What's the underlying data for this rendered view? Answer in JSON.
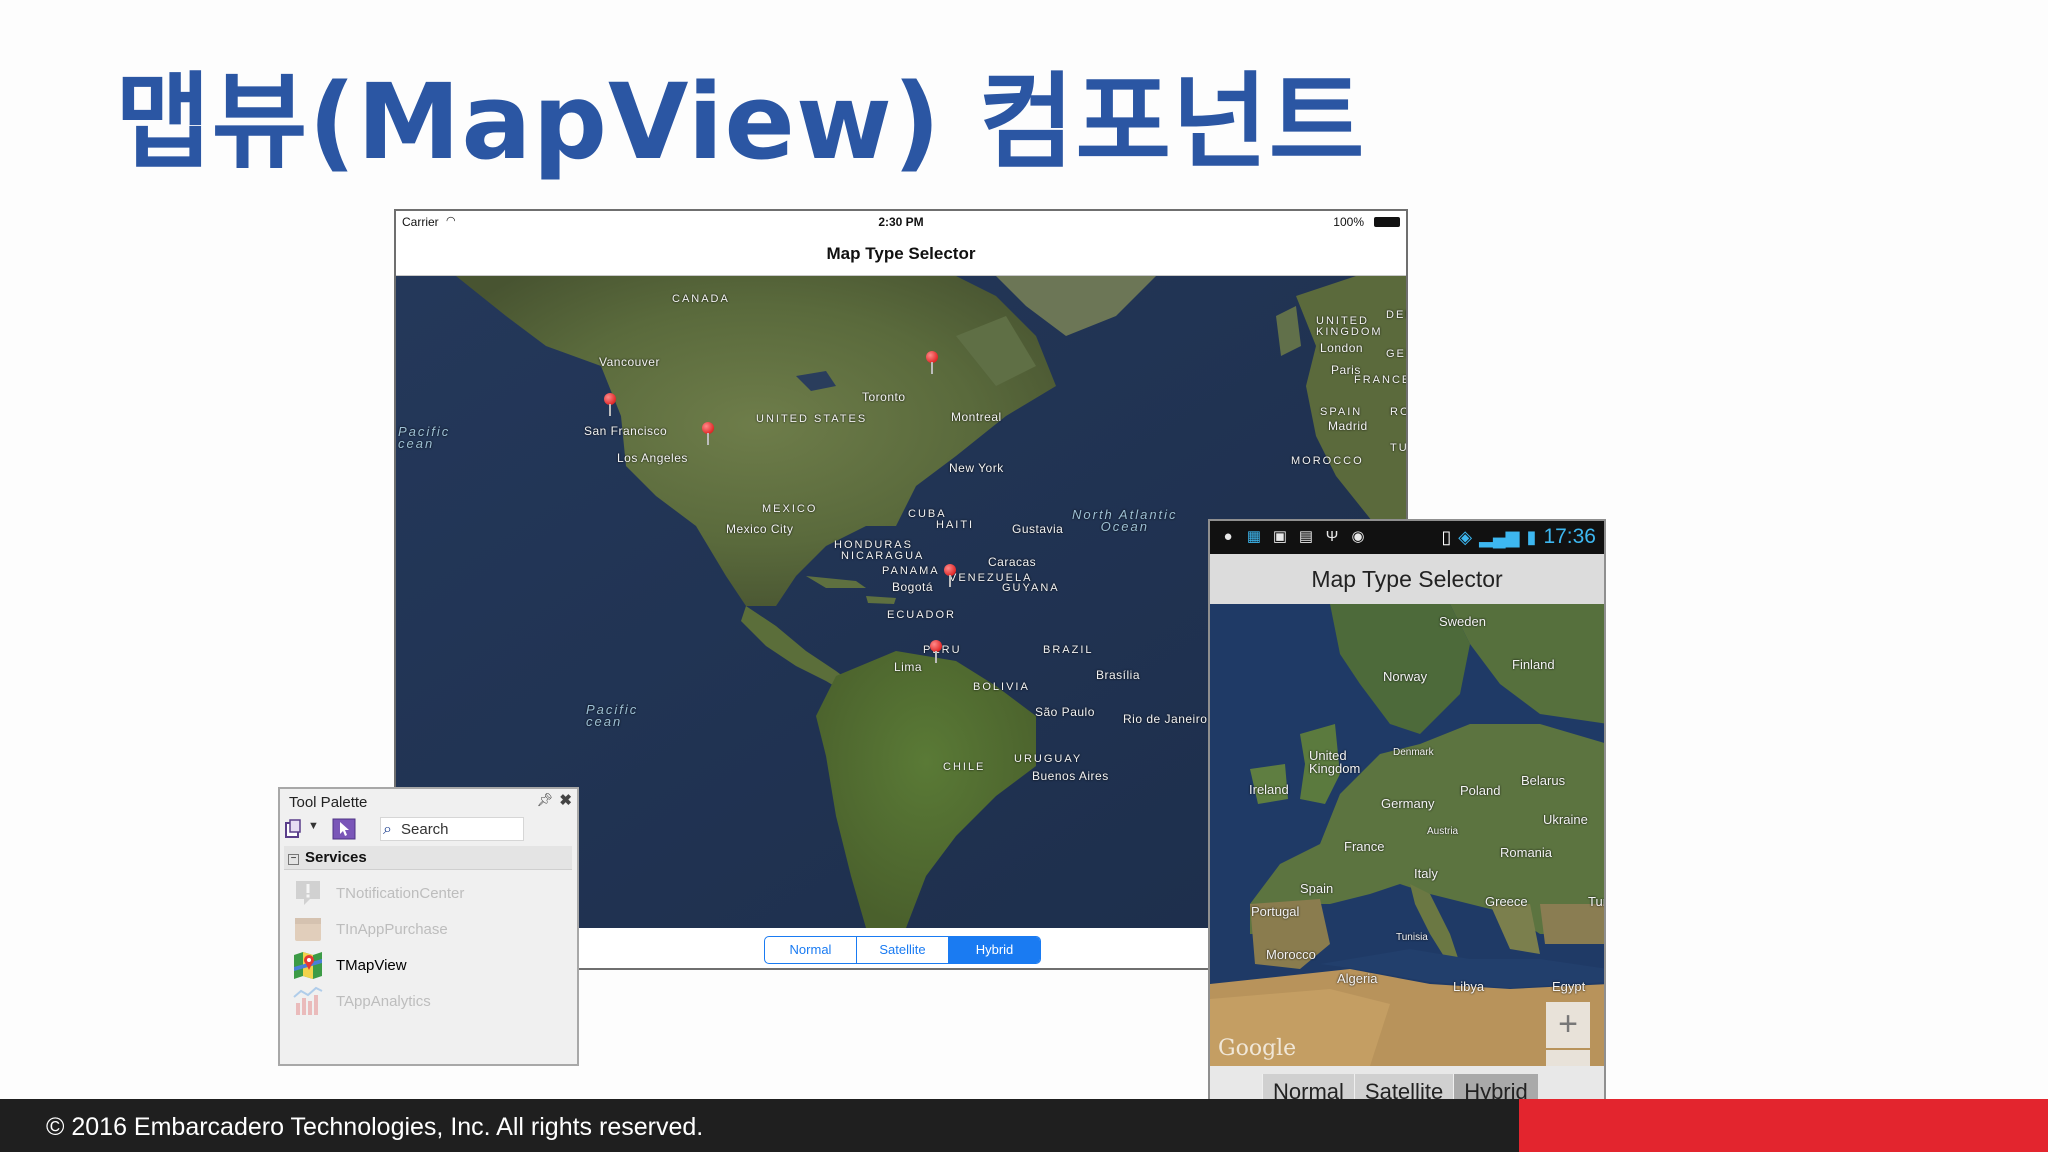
{
  "slide": {
    "title": "맵뷰(MapView) 컴포넌트",
    "copyright": "© 2016 Embarcadero Technologies, Inc. All rights reserved."
  },
  "ios_app": {
    "status": {
      "carrier": "Carrier",
      "time": "2:30 PM",
      "battery": "100%"
    },
    "title": "Map Type Selector",
    "map_labels": {
      "canada": "CANADA",
      "vancouver": "Vancouver",
      "san_francisco": "San Francisco",
      "los_angeles": "Los Angeles",
      "united_states": "UNITED STATES",
      "toronto": "Toronto",
      "montreal": "Montreal",
      "new_york": "New York",
      "north_atlantic": "North Atlantic\nOcean",
      "pacific_top": "Pacific\ncean",
      "mexico": "MEXICO",
      "mexico_city": "Mexico City",
      "cuba": "CUBA",
      "haiti": "HAITI",
      "gustavia": "Gustavia",
      "honduras": "HONDURAS",
      "nicaragua": "NICARAGUA",
      "panama": "PANAMA",
      "bogota": "Bogotá",
      "venezuela": "VENEZUELA",
      "caracas": "Caracas",
      "guyana": "GUYANA",
      "ecuador": "ECUADOR",
      "peru": "PERU",
      "brazil": "BRAZIL",
      "brasilia": "Brasília",
      "lima": "Lima",
      "bolivia": "BOLIVIA",
      "sao_paulo": "São Paulo",
      "rio": "Rio de Janeiro",
      "chile": "CHILE",
      "uruguay": "URUGUAY",
      "buenos_aires": "Buenos Aires",
      "pacific_bottom": "Pacific\ncean",
      "united_kingdom": "UNITED\nKINGDOM",
      "london": "London",
      "paris": "Paris",
      "france": "FRANCE",
      "spain": "SPAIN",
      "madrid": "Madrid",
      "morocco": "MOROCCO",
      "den": "DEN",
      "ger": "GER",
      "ro": "RO",
      "tu": "TU"
    },
    "segments": [
      "Normal",
      "Satellite",
      "Hybrid"
    ],
    "selected_segment": "Hybrid"
  },
  "android_app": {
    "status": {
      "time": "17:36"
    },
    "title": "Map Type Selector",
    "map_labels": {
      "sweden": "Sweden",
      "finland": "Finland",
      "norway": "Norway",
      "united_kingdom": "United\nKingdom",
      "denmark": "Denmark",
      "ireland": "Ireland",
      "poland": "Poland",
      "belarus": "Belarus",
      "germany": "Germany",
      "ukraine": "Ukraine",
      "austria": "Austria",
      "france": "France",
      "romania": "Romania",
      "italy": "Italy",
      "spain": "Spain",
      "portugal": "Portugal",
      "greece": "Greece",
      "tur": "Tur",
      "tunisia": "Tunisia",
      "morocco": "Morocco",
      "algeria": "Algeria",
      "libya": "Libya",
      "egypt": "Egypt",
      "google": "Google"
    },
    "zoom_in": "+",
    "zoom_out": "−",
    "segments": [
      "Normal",
      "Satellite",
      "Hybrid"
    ],
    "selected_segment": "Hybrid"
  },
  "tool_palette": {
    "title": "Tool Palette",
    "search_placeholder": "Search",
    "category": "Services",
    "items": [
      {
        "label": "TNotificationCenter",
        "enabled": false,
        "icon": "notification-icon"
      },
      {
        "label": "TInAppPurchase",
        "enabled": false,
        "icon": "purchase-icon"
      },
      {
        "label": "TMapView",
        "enabled": true,
        "icon": "map-icon"
      },
      {
        "label": "TAppAnalytics",
        "enabled": false,
        "icon": "analytics-icon"
      }
    ]
  },
  "colors": {
    "title_blue": "#2b56a3",
    "ios_blue": "#1a7bf2",
    "footer_red": "#e3252e"
  }
}
